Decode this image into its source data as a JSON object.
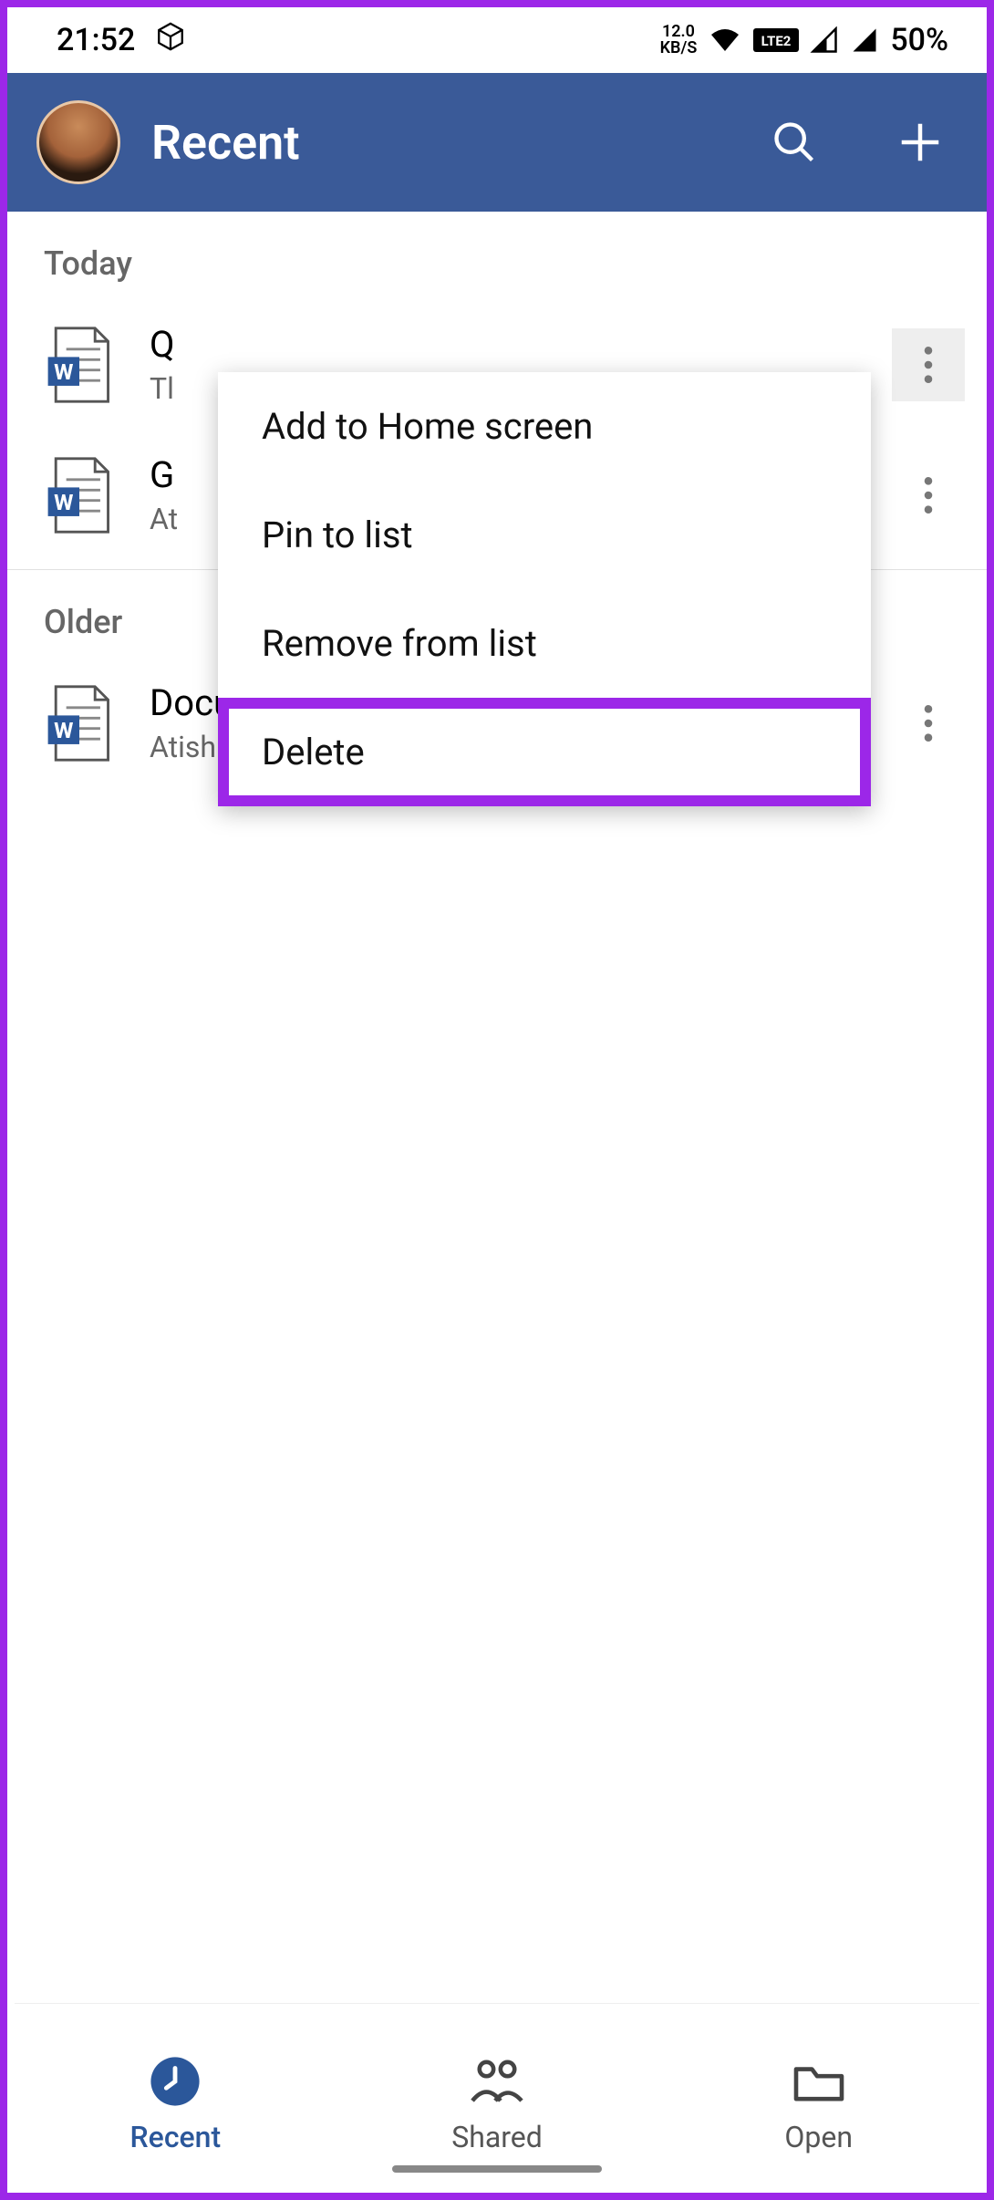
{
  "status": {
    "time": "21:52",
    "net_speed_top": "12.0",
    "net_speed_bottom": "KB/S",
    "battery": "50%"
  },
  "appbar": {
    "title": "Recent"
  },
  "sections": {
    "today": "Today",
    "older": "Older"
  },
  "files": {
    "today": [
      {
        "title_prefix": "Q",
        "sub_prefix": "Tl"
      },
      {
        "title_prefix": "G",
        "sub_prefix": "At"
      }
    ],
    "older": [
      {
        "title": "Document",
        "sub": "Atish Rajasekharan's…eDrive » Documents"
      }
    ]
  },
  "popup": {
    "items": [
      "Add to Home screen",
      "Pin to list",
      "Remove from list",
      "Delete"
    ]
  },
  "bottomnav": {
    "recent": "Recent",
    "shared": "Shared",
    "open": "Open"
  }
}
